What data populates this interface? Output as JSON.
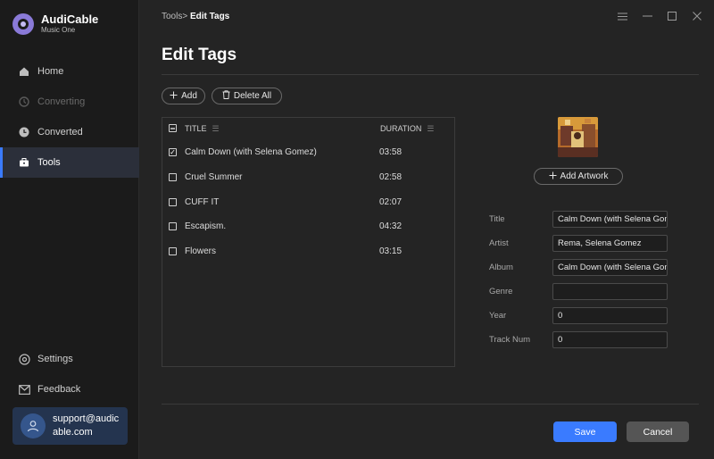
{
  "app": {
    "name": "AudiCable",
    "subtitle": "Music One"
  },
  "sidebar": {
    "items": [
      {
        "label": "Home",
        "icon": "home-icon",
        "state": "normal"
      },
      {
        "label": "Converting",
        "icon": "converting-icon",
        "state": "disabled"
      },
      {
        "label": "Converted",
        "icon": "clock-icon",
        "state": "normal"
      },
      {
        "label": "Tools",
        "icon": "toolbox-icon",
        "state": "active"
      }
    ],
    "bottom": [
      {
        "label": "Settings",
        "icon": "gear-icon"
      },
      {
        "label": "Feedback",
        "icon": "mail-icon"
      }
    ],
    "user": {
      "email": "support@audicable.com",
      "icon": "user-icon"
    }
  },
  "breadcrumb": {
    "parent": "Tools",
    "sep": ">",
    "current": "Edit Tags"
  },
  "window_controls": [
    "menu-icon",
    "minimize-icon",
    "maximize-icon",
    "close-icon"
  ],
  "page": {
    "title": "Edit Tags"
  },
  "toolbar": {
    "add_label": "Add",
    "delete_all_label": "Delete All"
  },
  "table": {
    "headers": {
      "title": "TITLE",
      "duration": "DURATION"
    },
    "rows": [
      {
        "title": "Calm Down (with Selena Gomez)",
        "duration": "03:58",
        "checked": true
      },
      {
        "title": "Cruel Summer",
        "duration": "02:58",
        "checked": false
      },
      {
        "title": "CUFF IT",
        "duration": "02:07",
        "checked": false
      },
      {
        "title": "Escapism.",
        "duration": "04:32",
        "checked": false
      },
      {
        "title": "Flowers",
        "duration": "03:15",
        "checked": false
      }
    ]
  },
  "editor": {
    "add_artwork_label": "Add Artwork",
    "fields": [
      {
        "label": "Title",
        "value": "Calm Down (with Selena Gomez)"
      },
      {
        "label": "Artist",
        "value": "Rema, Selena Gomez"
      },
      {
        "label": "Album",
        "value": "Calm Down (with Selena Gomez)"
      },
      {
        "label": "Genre",
        "value": ""
      },
      {
        "label": "Year",
        "value": "0"
      },
      {
        "label": "Track Num",
        "value": "0"
      }
    ]
  },
  "actions": {
    "save_label": "Save",
    "cancel_label": "Cancel"
  },
  "colors": {
    "accent": "#3a7bff",
    "sidebar_bg": "#1b1b1b",
    "main_bg": "#242424",
    "user_card": "#24344f"
  }
}
